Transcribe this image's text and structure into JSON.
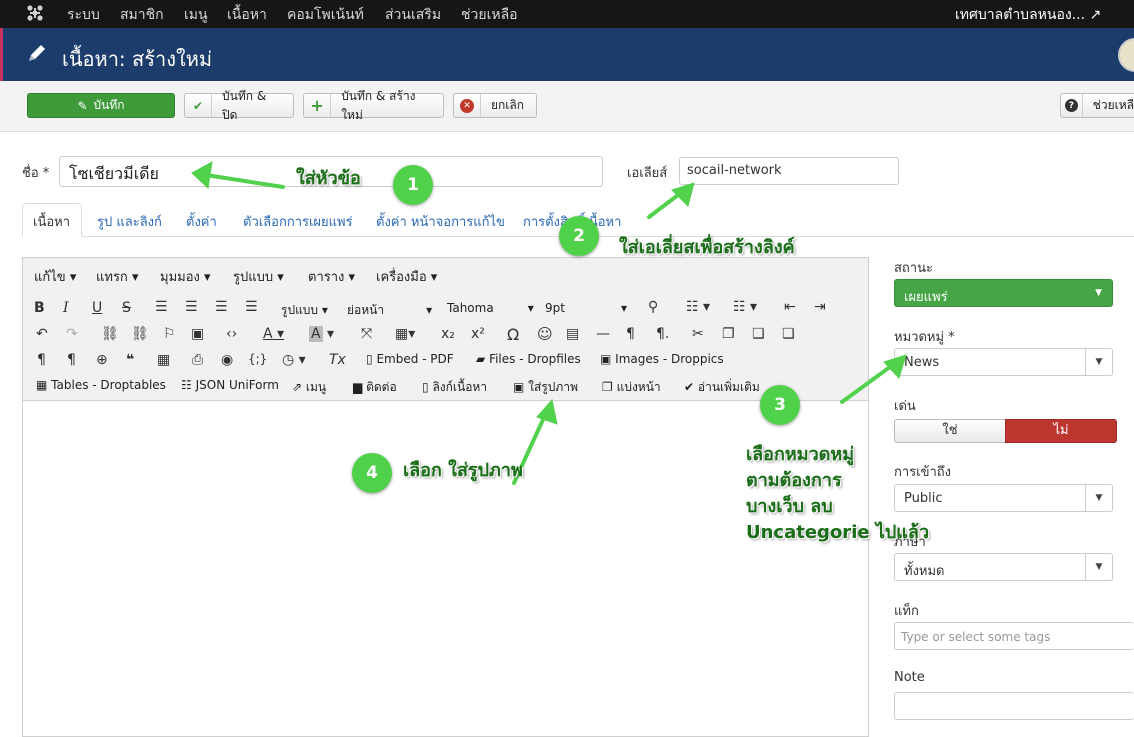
{
  "topbar": {
    "logo": "joomla-icon",
    "menu": [
      "ระบบ",
      "สมาชิก",
      "เมนู",
      "เนื้อหา",
      "คอมโพเน้นท์",
      "ส่วนเสริม",
      "ช่วยเหลือ"
    ],
    "site_link": "เทศบาลตำบลหนอง... ↗"
  },
  "header": {
    "title": "เนื้อหา: สร้างใหม่"
  },
  "toolbar": {
    "save": "บันทึก",
    "save_close": "บันทึก & ปิด",
    "save_new": "บันทึก & สร้างใหม่",
    "cancel": "ยกเลิก",
    "help": "ช่วยเหลื"
  },
  "form": {
    "title_label": "ชื่อ *",
    "title_value": "โซเชียวมีเดีย",
    "alias_label": "เอเลียส์",
    "alias_value": "socail-network"
  },
  "tabs": [
    "เนื้อหา",
    "รูป และลิงก์",
    "ตั้งค่า",
    "ตัวเลือกการเผยแพร่",
    "ตั้งค่า หน้าจอการแก้ไข",
    "การตั้งสิทธิ์เนื้อหา"
  ],
  "editor": {
    "menus": [
      "แก้ไข",
      "แทรก",
      "มุมมอง",
      "รูปแบบ",
      "ตาราง",
      "เครื่องมือ"
    ],
    "format_select": "รูปแบบ",
    "paragraph_select": "ย่อหน้า",
    "font_select": "Tahoma",
    "size_select": "9pt",
    "plugins_row3": [
      "Embed - PDF",
      "Files - Dropfiles",
      "Images - Droppics"
    ],
    "plugins_row4": [
      "Tables - Droptables",
      "JSON UniForm",
      "เมนู",
      "ติดต่อ",
      "ลิงก์เนื้อหา",
      "ใส่รูปภาพ",
      "แบ่งหน้า",
      "อ่านเพิ่มเติม"
    ]
  },
  "sidebar": {
    "status_label": "สถานะ",
    "status_value": "เผยแพร่",
    "category_label": "หมวดหมู่ *",
    "category_value": "News",
    "featured_label": "เด่น",
    "featured_yes": "ใช่",
    "featured_no": "ไม่",
    "access_label": "การเข้าถึง",
    "access_value": "Public",
    "language_label": "ภาษา",
    "language_value": "ทั้งหมด",
    "tags_label": "แท็ก",
    "tags_placeholder": "Type or select some tags",
    "note_label": "Note"
  },
  "annotations": [
    {
      "number": "1",
      "text": "ใส่หัวข้อ"
    },
    {
      "number": "2",
      "text": "ใส่เอเลี่ยสเพื่อสร้างลิงค์"
    },
    {
      "number": "3",
      "lines": [
        "เลือกหมวดหมู่",
        "ตามต้องการ",
        "บางเว็บ ลบ",
        "Uncategorie ไปแล้ว"
      ]
    },
    {
      "number": "4",
      "text": "เลือก ใส่รูปภาพ"
    }
  ],
  "colors": {
    "topbar": "#161616",
    "titlebar": "#1c3d6c",
    "save_green": "#3f9b3a",
    "status_green": "#46a546",
    "no_red": "#bd362f",
    "annotation_green": "#4fd14a",
    "annotation_text": "#1a6e18"
  }
}
